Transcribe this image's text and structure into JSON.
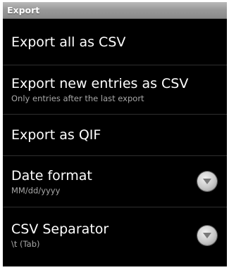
{
  "title_bar": {
    "title": "Export"
  },
  "items": [
    {
      "title": "Export all as CSV",
      "summary": ""
    },
    {
      "title": "Export new entries as CSV",
      "summary": "Only entries after the last export"
    },
    {
      "title": "Export as QIF",
      "summary": ""
    },
    {
      "title": "Date format",
      "summary": "MM/dd/yyyy",
      "icon": "chevron-down-icon"
    },
    {
      "title": "CSV Separator",
      "summary": "\\t (Tab)",
      "icon": "chevron-down-icon"
    }
  ]
}
